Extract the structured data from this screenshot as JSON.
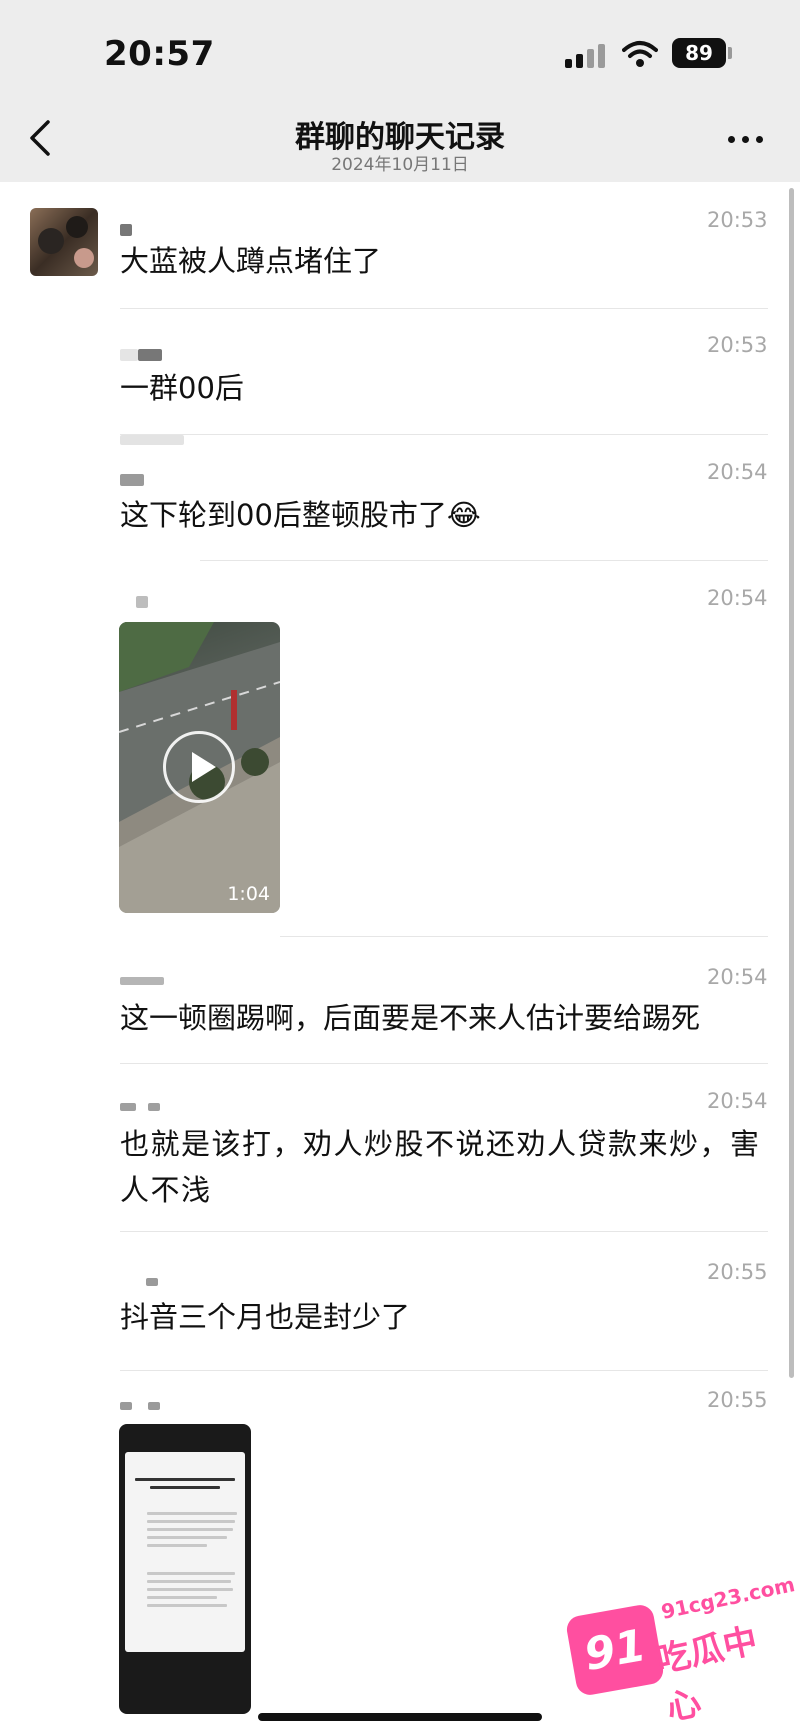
{
  "status_bar": {
    "time": "20:57",
    "battery": "89"
  },
  "header": {
    "title": "群聊的聊天记录",
    "date": "2024年10月11日"
  },
  "messages": [
    {
      "time": "20:53",
      "text": "大蓝被人蹲点堵住了"
    },
    {
      "time": "20:53",
      "text": "一群00后"
    },
    {
      "time": "20:54",
      "text": "这下轮到00后整顿股市了😂"
    },
    {
      "time": "20:54",
      "video_duration": "1:04"
    },
    {
      "time": "20:54",
      "text": "这一顿圈踢啊，后面要是不来人估计要给踢死"
    },
    {
      "time": "20:54",
      "text": "也就是该打，劝人炒股不说还劝人贷款来炒，害人不浅"
    },
    {
      "time": "20:55",
      "text": "抖音三个月也是封少了"
    },
    {
      "time": "20:55"
    }
  ],
  "watermark": {
    "number": "91",
    "url": "91cg23.com",
    "name": "吃瓜中心"
  }
}
